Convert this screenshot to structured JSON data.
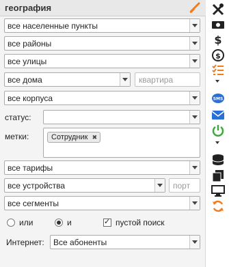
{
  "header": {
    "title": "география",
    "brush_icon": "brush-icon"
  },
  "filters": {
    "settlement": "все населенные пункты",
    "district": "все районы",
    "street": "все улицы",
    "house": "все дома",
    "apartment_placeholder": "квартира",
    "building": "все корпуса",
    "status_label": "статус:",
    "status_value": "",
    "tags_label": "метки:",
    "tags": [
      "Сотрудник"
    ],
    "tag_remove": "✖",
    "tariff": "все тарифы",
    "device": "все устройства",
    "port_placeholder": "порт",
    "segment": "все сегменты",
    "or_label": "или",
    "and_label": "и",
    "empty_search_label": "пустой поиск",
    "mode_selected": "and",
    "empty_search_checked": true,
    "internet_label": "Интернет:",
    "internet_value": "Все абоненты"
  },
  "toolbar_icons": [
    "wrench-screwdriver-icon",
    "cash-icon",
    "dollar-icon",
    "currency-exchange-icon",
    "task-list-icon",
    "sms-icon",
    "mail-icon",
    "power-icon",
    "database-icon",
    "copy-icon",
    "monitor-icon",
    "refresh-icon"
  ],
  "colors": {
    "accent_orange": "#f07c1e",
    "sms_blue": "#2a6fd6",
    "power_green": "#3aa83a"
  }
}
